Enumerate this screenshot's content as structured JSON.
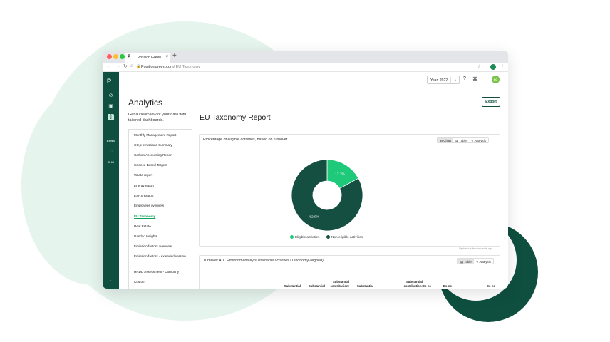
{
  "browser": {
    "tab_title": "Position Green",
    "tab_logo": "P",
    "close_glyph": "×",
    "new_tab_glyph": "+",
    "url_host": "Positiongreen.com",
    "url_path": "/ EU Taxonomy",
    "traffic_lights": [
      "#ff5f57",
      "#febc2e",
      "#28c840"
    ]
  },
  "sidebar": {
    "logo": "P",
    "icons": [
      {
        "name": "dashboard-icon",
        "glyph": "⊘"
      },
      {
        "name": "report-icon",
        "glyph": "▣"
      },
      {
        "name": "analytics-icon",
        "glyph": "⫿",
        "active": true
      }
    ],
    "texts": [
      "ESRS",
      "GHG"
    ],
    "collapse_glyph": "→|"
  },
  "topbar": {
    "year_select": "Year: 2022",
    "chevron": "⌄",
    "avatar_initials": "SG"
  },
  "analytics": {
    "title": "Analytics",
    "subtitle": "Get a clear view of your data with tailored dashboards.",
    "reports": [
      "Monthly Management Report",
      "CO₂e emissions Summary",
      "Carbon Accounting Report",
      "Science Based Targets",
      "Waste report",
      "Energy report",
      "ESRS Report",
      "Employees overview",
      "EU Taxonomy",
      "Real Estate",
      "Nasdaq Insights",
      "Emission factors overview",
      "Emission factors - extended version",
      "HRDD Assessment - Company",
      "Custom"
    ],
    "active_report": "EU Taxonomy"
  },
  "main": {
    "export_label": "Export",
    "report_title": "EU Taxonomy Report",
    "card1": {
      "title": "Procentage of eligible activities, based on turnover",
      "view_chart": "Chart",
      "view_table": "Table",
      "view_analysis": "Analysis",
      "updated": "Updated a few seconds ago"
    },
    "card2": {
      "title": "Turnover A.1. Environmentally sustainable activities (Taxonomy-aligned)",
      "view_table": "Table",
      "view_analysis": "Analysis",
      "headers": [
        "Substantial",
        "Substantial",
        "Substantial\ncontribution:",
        "Substantial",
        "Substantial\ncontribution:",
        "Do no",
        "Do no",
        "Do no"
      ]
    }
  },
  "chart_data": {
    "type": "pie",
    "donut": true,
    "title": "Procentage of eligible activities, based on turnover",
    "slices": [
      {
        "name": "Eligible activities",
        "value": 17.1,
        "label": "17.1%",
        "color": "#1ec97a"
      },
      {
        "name": "Non-eligible activities",
        "value": 82.9,
        "label": "82.9%",
        "color": "#144f42"
      }
    ],
    "legend_position": "bottom"
  }
}
